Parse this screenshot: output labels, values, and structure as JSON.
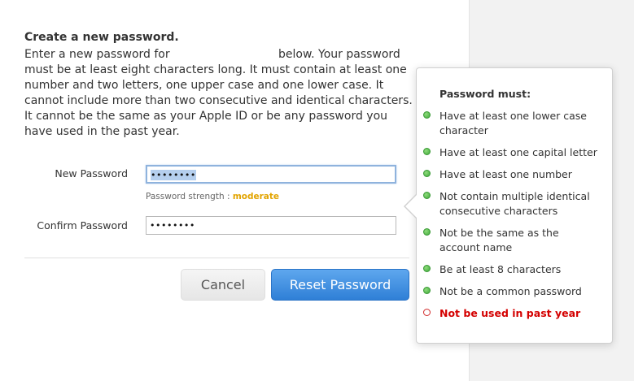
{
  "form": {
    "heading": "Create a new password.",
    "instructions_part1": "Enter a new password for",
    "instructions_part2": "below. Your password",
    "instructions_rest": "must be at least eight characters long. It must contain at least one number and two letters, one upper case and one lower case. It cannot include more than two consecutive and identical characters. It cannot be the same as your Apple ID or be any password you have used in the past year.",
    "new_password_label": "New Password",
    "new_password_value": "••••••••",
    "strength_label": "Password strength :",
    "strength_value": "moderate",
    "confirm_password_label": "Confirm Password",
    "confirm_password_value": "••••••••",
    "cancel_label": "Cancel",
    "reset_label": "Reset Password"
  },
  "popover": {
    "title": "Password must:",
    "rules": [
      {
        "text": "Have at least one lower case character",
        "status": "ok"
      },
      {
        "text": "Have at least one capital letter",
        "status": "ok"
      },
      {
        "text": "Have at least one number",
        "status": "ok"
      },
      {
        "text": "Not contain multiple identical consecutive characters",
        "status": "ok"
      },
      {
        "text": "Not be the same as the account name",
        "status": "ok"
      },
      {
        "text": "Be at least 8 characters",
        "status": "ok"
      },
      {
        "text": "Not be a common password",
        "status": "ok"
      },
      {
        "text": "Not be used in past year",
        "status": "fail"
      }
    ]
  },
  "colors": {
    "accent": "#2f7fd6",
    "ok": "#3fa83a",
    "fail": "#d40000",
    "strength_moderate": "#e2a400"
  }
}
